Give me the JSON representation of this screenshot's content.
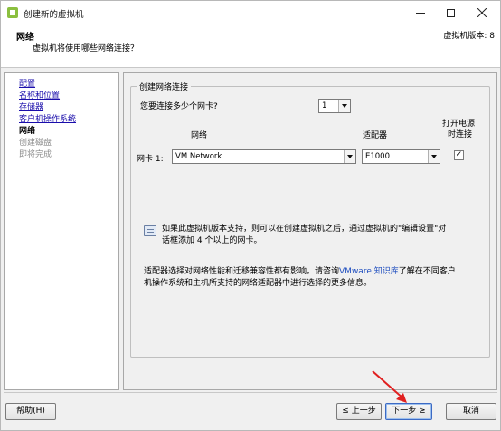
{
  "window": {
    "title": "创建新的虚拟机",
    "controls": {
      "minimize": "minimize",
      "maximize": "maximize",
      "close": "close"
    }
  },
  "header": {
    "title": "网络",
    "subtitle": "虚拟机将使用哪些网络连接？",
    "version": "虚拟机版本: 8"
  },
  "nav": {
    "items": [
      {
        "label": "配置",
        "state": "link"
      },
      {
        "label": "名称和位置",
        "state": "link"
      },
      {
        "label": "存储器",
        "state": "link"
      },
      {
        "label": "客户机操作系统",
        "state": "link"
      },
      {
        "label": "网络",
        "state": "current"
      },
      {
        "label": "创建磁盘",
        "state": "disabled"
      },
      {
        "label": "即将完成",
        "state": "disabled"
      }
    ]
  },
  "group": {
    "legend": "创建网络连接",
    "nic_count_label": "您要连接多少个网卡?",
    "nic_count_value": "1",
    "col_network": "网络",
    "col_adapter": "适配器",
    "col_power_line1": "打开电源",
    "col_power_line2": "时连接",
    "nic1_label": "网卡 1:",
    "nic1_network": "VM Network",
    "nic1_adapter": "E1000",
    "nic1_connect_checked": "✓",
    "info_text_line1": "如果此虚拟机版本支持，则可以在创建虚拟机之后，通过虚拟机的\"编辑设置\"对",
    "info_text_line2": "话框添加 4 个以上的网卡。",
    "adapter_note_line1_pre": "适配器选择对网络性能和迁移兼容性都有影响。请咨询",
    "adapter_note_link": "VMware 知识库",
    "adapter_note_line1_post": "了解在不同客户",
    "adapter_note_line2": "机操作系统和主机所支持的网络适配器中进行选择的更多信息。"
  },
  "footer": {
    "help": "帮助(H)",
    "back": "≤ 上一步",
    "next": "下一步 ≥",
    "cancel": "取消"
  },
  "colors": {
    "link": "#1a0dab",
    "annotation_arrow": "#e02020",
    "default_button_border": "#3c6ac4"
  }
}
